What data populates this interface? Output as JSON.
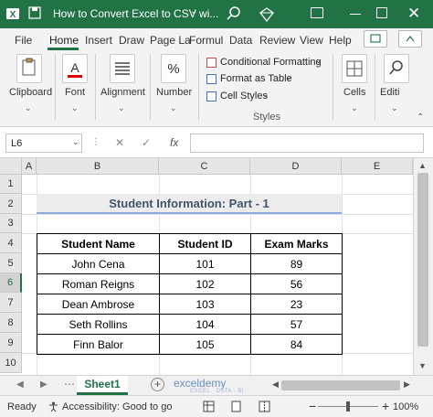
{
  "window": {
    "title": "How to Convert Excel to CSV wi...",
    "caret": "⌄"
  },
  "tabs": [
    {
      "label": "File"
    },
    {
      "label": "Home"
    },
    {
      "label": "Insert"
    },
    {
      "label": "Draw"
    },
    {
      "label": "Page La"
    },
    {
      "label": "Formul"
    },
    {
      "label": "Data"
    },
    {
      "label": "Review"
    },
    {
      "label": "View"
    },
    {
      "label": "Help"
    }
  ],
  "ribbon": {
    "groups": [
      {
        "label": "Clipboard",
        "icon": "clipboard-icon"
      },
      {
        "label": "Font",
        "icon": "font-color-icon"
      },
      {
        "label": "Alignment",
        "icon": "alignment-icon"
      },
      {
        "label": "Number",
        "icon": "percent-icon"
      },
      {
        "label": "Cells",
        "icon": "cells-icon"
      },
      {
        "label": "Editi",
        "icon": "search-icon"
      }
    ],
    "styles": {
      "conditional": "Conditional Formatting",
      "table": "Format as Table",
      "cell": "Cell Styles",
      "label": "Styles"
    }
  },
  "formula_bar": {
    "name_box": "L6",
    "cancel": "✕",
    "confirm": "✓",
    "fx": "fx",
    "value": ""
  },
  "grid": {
    "columns": [
      "A",
      "B",
      "C",
      "D",
      "E"
    ],
    "rows": [
      "1",
      "2",
      "3",
      "4",
      "5",
      "6",
      "7",
      "8",
      "9",
      "10"
    ],
    "title": "Student Information: Part - 1",
    "headers": [
      "Student Name",
      "Student ID",
      "Exam Marks"
    ],
    "data": [
      [
        "John Cena",
        "101",
        "89"
      ],
      [
        "Roman Reigns",
        "102",
        "56"
      ],
      [
        "Dean Ambrose",
        "103",
        "23"
      ],
      [
        "Seth Rollins",
        "104",
        "57"
      ],
      [
        "Finn Balor",
        "105",
        "84"
      ]
    ]
  },
  "sheets": {
    "active": "Sheet1",
    "add": "+",
    "watermark": "exceldemy",
    "watermark_sub": "EXCEL · DATA · BI"
  },
  "status": {
    "ready": "Ready",
    "accessibility": "Accessibility: Good to go",
    "zoom": "100%",
    "zoom_out": "−",
    "zoom_in": "+"
  },
  "colors": {
    "accent": "#217346",
    "title_text": "#44546a",
    "title_underline": "#8faadc"
  }
}
